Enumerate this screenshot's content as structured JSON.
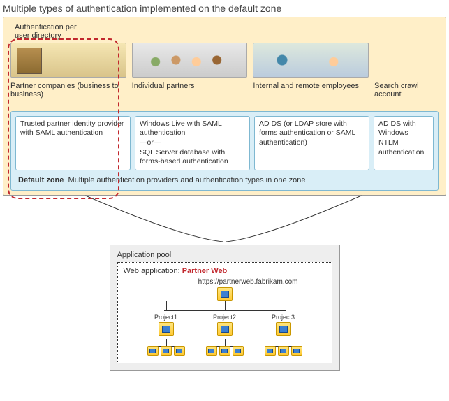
{
  "title": "Multiple types of authentication implemented on the default zone",
  "subTitle": "Authentication per user directory",
  "columns": {
    "partner": {
      "label": "Partner companies (business to business)",
      "auth": "Trusted partner identity provider with SAML authentication"
    },
    "individual": {
      "label": "Individual partners",
      "auth": "Windows Live with SAML authentication\n—or—\nSQL Server database with forms-based authentication"
    },
    "internal": {
      "label": "Internal and remote employees",
      "auth": "AD DS  (or LDAP store with forms authentication or SAML authentication)"
    },
    "search": {
      "label": "Search crawl account",
      "auth": "AD DS with Windows NTLM authentication"
    }
  },
  "zone": {
    "name": "Default zone",
    "desc": "Multiple authentication providers and authentication types in one zone"
  },
  "appPool": {
    "title": "Application pool",
    "webAppLabel": "Web application:",
    "webAppName": "Partner Web",
    "url": "https://partnerweb.fabrikam.com",
    "projects": [
      "Project1",
      "Project2",
      "Project3"
    ]
  },
  "chart_data": {
    "type": "table",
    "title": "Authentication per user directory mapped to a single default zone",
    "series": [
      {
        "name": "Partner companies (business to business)",
        "values": [
          "Trusted partner identity provider with SAML authentication"
        ]
      },
      {
        "name": "Individual partners",
        "values": [
          "Windows Live with SAML authentication",
          "SQL Server database with forms-based authentication"
        ]
      },
      {
        "name": "Internal and remote employees",
        "values": [
          "AD DS (or LDAP store with forms authentication or SAML authentication)"
        ]
      },
      {
        "name": "Search crawl account",
        "values": [
          "AD DS with Windows NTLM authentication"
        ]
      }
    ],
    "zone": "Default zone",
    "application": {
      "pool": "Application pool",
      "webApp": "Partner Web",
      "url": "https://partnerweb.fabrikam.com",
      "sites": [
        "Project1",
        "Project2",
        "Project3"
      ],
      "subsitesPerProject": 3
    }
  }
}
